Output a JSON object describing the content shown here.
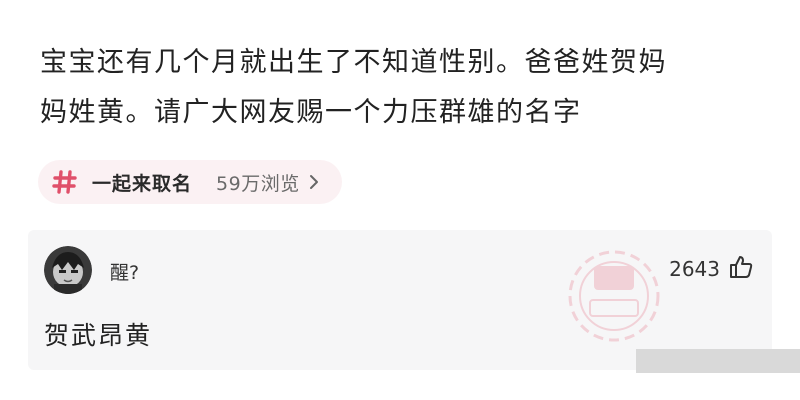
{
  "post": {
    "line1": "宝宝还有几个月就出生了不知道性别。爸爸姓贺妈",
    "line2": "妈姓黄。请广大网友赐一个力压群雄的名字"
  },
  "topic": {
    "icon": "hash-icon",
    "name": "一起来取名",
    "views": "59万浏览"
  },
  "comment": {
    "username": "醒?",
    "likes": "2643",
    "text": "贺武昂黄"
  },
  "colors": {
    "accent": "#e0506a",
    "chip_bg": "#fbf1f3",
    "card_bg": "#f6f6f7"
  }
}
